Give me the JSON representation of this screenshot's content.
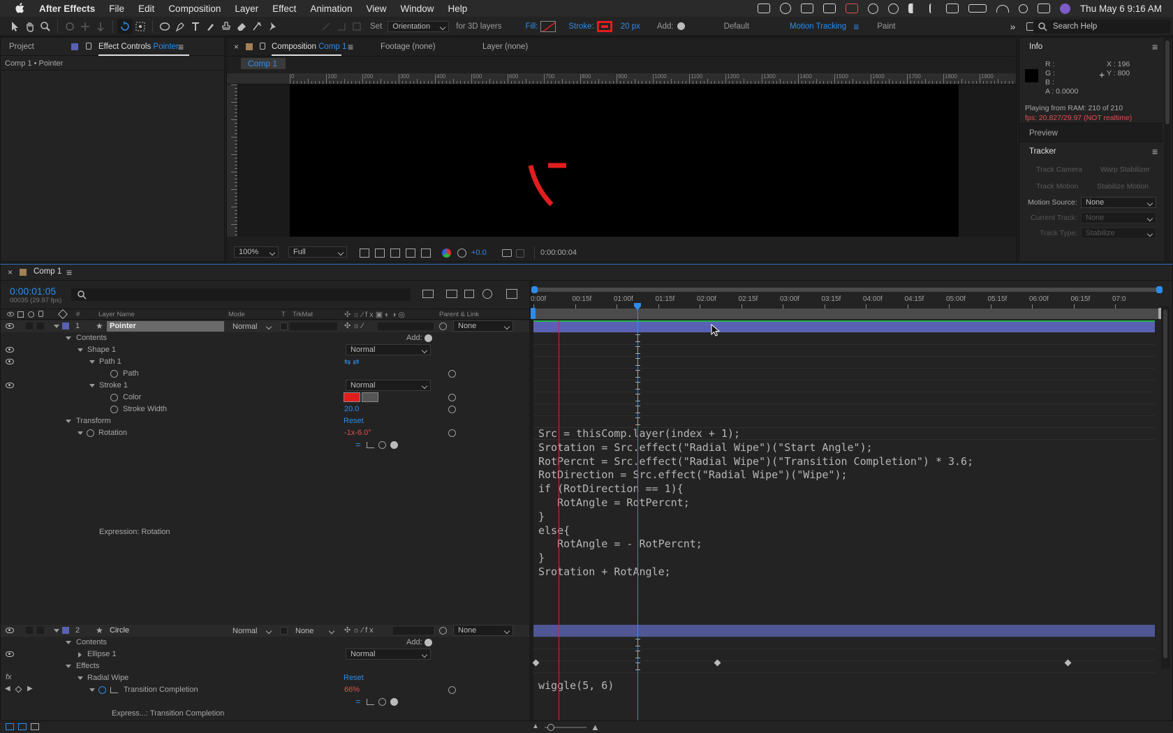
{
  "menubar": {
    "items": [
      "After Effects",
      "File",
      "Edit",
      "Composition",
      "Layer",
      "Effect",
      "Animation",
      "View",
      "Window",
      "Help"
    ],
    "clock": "Thu May 6  9:16 AM"
  },
  "toolbar": {
    "set_label": "Set",
    "orientation_value": "Orientation",
    "for3d_label": "for 3D layers",
    "fill_label": "Fill:",
    "stroke_label": "Stroke:",
    "stroke_width": "20 px",
    "add_label": "Add:",
    "workspaces": [
      "Default",
      "Motion Tracking",
      "Paint"
    ],
    "search_placeholder": "Search Help"
  },
  "left_panel": {
    "tab_project": "Project",
    "tab_effect_controls_prefix": "Effect Controls",
    "tab_effect_controls_layer": "Pointer",
    "breadcrumb": "Comp 1 • Pointer"
  },
  "comp_panel": {
    "tab_composition_prefix": "Composition",
    "tab_composition_name": "Comp 1",
    "tab_footage": "Footage (none)",
    "tab_layer": "Layer (none)",
    "comp_chip": "Comp 1",
    "ruler_labels": [
      "0",
      "100",
      "200",
      "300",
      "400",
      "500",
      "600",
      "700",
      "800",
      "900",
      "1000",
      "1100",
      "1200",
      "1300",
      "1400",
      "1500",
      "1600",
      "1700",
      "1800",
      "1900",
      "2000"
    ],
    "zoom": "100%",
    "resolution": "Full",
    "exposure": "+0.0",
    "timecode": "0:00:00:04",
    "accent": "#e01e1e"
  },
  "info_panel": {
    "title": "Info",
    "r": "R :",
    "g": "G :",
    "b": "B :",
    "a": "A :  0.0000",
    "x": "X : 196",
    "y": "Y : 800",
    "playing": "Playing from RAM: 210 of 210",
    "fps": "fps: 20.827/29.97 (NOT realtime)",
    "preview": "Preview",
    "tracker": "Tracker",
    "track_camera": "Track Camera",
    "warp_stabilizer": "Warp Stabilizer",
    "track_motion": "Track Motion",
    "stabilize_motion": "Stabilize Motion",
    "motion_source_label": "Motion Source:",
    "motion_source_value": "None",
    "current_track_label": "Current Track:",
    "current_track_value": "None",
    "track_type_label": "Track Type:",
    "track_type_value": "Stabilize"
  },
  "timeline": {
    "tab": "Comp 1",
    "timecode": "0:00:01:05",
    "frames": "00035 (29.97 fps)",
    "col_layer_name": "Layer Name",
    "col_mode": "Mode",
    "col_t": "T",
    "col_trkmat": "TrkMat",
    "col_parent": "Parent & Link",
    "ruler": [
      "0:00f",
      "00:15f",
      "01:00f",
      "01:15f",
      "02:00f",
      "02:15f",
      "03:00f",
      "03:15f",
      "04:00f",
      "04:15f",
      "05:00f",
      "05:15f",
      "06:00f",
      "06:15f",
      "07:0"
    ],
    "layer1": {
      "num": "1",
      "name": "Pointer",
      "mode": "Normal",
      "parent": "None",
      "contents": "Contents",
      "add": "Add:",
      "shape1": "Shape 1",
      "shape1_mode": "Normal",
      "path1": "Path 1",
      "path": "Path",
      "stroke1": "Stroke 1",
      "stroke1_mode": "Normal",
      "color": "Color",
      "stroke_width": "Stroke Width",
      "stroke_width_value": "20.0",
      "transform": "Transform",
      "reset": "Reset",
      "rotation": "Rotation",
      "rotation_value": "-1x-6.0°",
      "expression_label": "Expression: Rotation"
    },
    "expression_code": "Src = thisComp.layer(index + 1);\nSrotation = Src.effect(\"Radial Wipe\")(\"Start Angle\");\nRotPercnt = Src.effect(\"Radial Wipe\")(\"Transition Completion\") * 3.6;\nRotDirection = Src.effect(\"Radial Wipe\")(\"Wipe\");\nif (RotDirection == 1){\n   RotAngle = RotPercnt;\n}\nelse{\n   RotAngle = - RotPercnt;\n}\nSrotation + RotAngle;",
    "layer2": {
      "num": "2",
      "name": "Circle",
      "mode": "Normal",
      "trkmat": "None",
      "parent": "None",
      "contents": "Contents",
      "add": "Add:",
      "ellipse1": "Ellipse 1",
      "ellipse1_mode": "Normal",
      "effects": "Effects",
      "radial_wipe": "Radial Wipe",
      "reset": "Reset",
      "transition_completion": "Transition Completion",
      "transition_value": "66%",
      "expression_label": "Express...: Transition Completion",
      "expression_code": "wiggle(5, 6)"
    }
  }
}
